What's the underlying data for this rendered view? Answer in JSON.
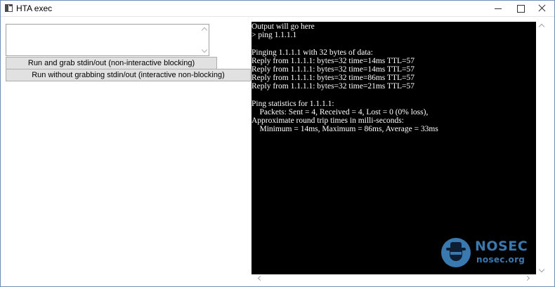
{
  "window": {
    "title": "HTA exec",
    "icon": "app-window-icon",
    "controls": [
      "minimize-icon",
      "maximize-icon",
      "close-icon"
    ]
  },
  "input": {
    "value": ""
  },
  "buttons": {
    "grab_label": "Run and grab stdin/out (non-interactive blocking)",
    "nograb_label": "Run without grabbing stdin/out (interactive non-blocking)"
  },
  "console": {
    "background": "#000000",
    "foreground": "#ffffff",
    "lines": [
      "Output will go here",
      "> ping 1.1.1.1",
      "",
      "Pinging 1.1.1.1 with 32 bytes of data:",
      "Reply from 1.1.1.1: bytes=32 time=14ms TTL=57",
      "Reply from 1.1.1.1: bytes=32 time=14ms TTL=57",
      "Reply from 1.1.1.1: bytes=32 time=86ms TTL=57",
      "Reply from 1.1.1.1: bytes=32 time=21ms TTL=57",
      "",
      "Ping statistics for 1.1.1.1:",
      "    Packets: Sent = 4, Received = 4, Lost = 0 (0% loss),",
      "Approximate round trip times in milli-seconds:",
      "    Minimum = 14ms, Maximum = 86ms, Average = 33ms"
    ]
  },
  "watermark": {
    "brand": "NOSEC",
    "url": "nosec.org",
    "icon": "spy-hat-icon",
    "color": "#3a78b0"
  }
}
